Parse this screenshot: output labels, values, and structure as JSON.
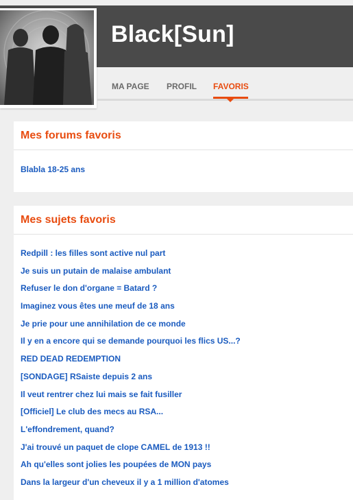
{
  "profile": {
    "username": "Black[Sun]",
    "avatar_icon": "silhouettes-avatar"
  },
  "tabs": [
    {
      "label": "MA PAGE",
      "active": false
    },
    {
      "label": "PROFIL",
      "active": false
    },
    {
      "label": "FAVORIS",
      "active": true
    }
  ],
  "colors": {
    "accent": "#e84c10",
    "link": "#1a5bbf",
    "header_bg": "#4a4a4a"
  },
  "favorite_forums": {
    "title": "Mes forums favoris",
    "items": [
      "Blabla 18-25 ans"
    ]
  },
  "favorite_topics": {
    "title": "Mes sujets favoris",
    "items": [
      "Redpill : les filles sont active nul part",
      "Je suis un putain de malaise ambulant",
      "Refuser le don d'organe = Batard ?",
      "Imaginez vous êtes une meuf de 18 ans",
      "Je prie pour une annihilation de ce monde",
      "Il y en a encore qui se demande pourquoi les flics US...?",
      "RED DEAD REDEMPTION",
      "[SONDAGE] RSaiste depuis 2 ans",
      "Il veut rentrer chez lui mais se fait fusiller",
      "[Officiel] Le club des mecs au RSA...",
      "L'effondrement, quand?",
      "J'ai trouvé un paquet de clope CAMEL de 1913 !!",
      "Ah qu'elles sont jolies les poupées de MON pays",
      "Dans la largeur d'un cheveux il y a 1 million d'atomes"
    ]
  }
}
